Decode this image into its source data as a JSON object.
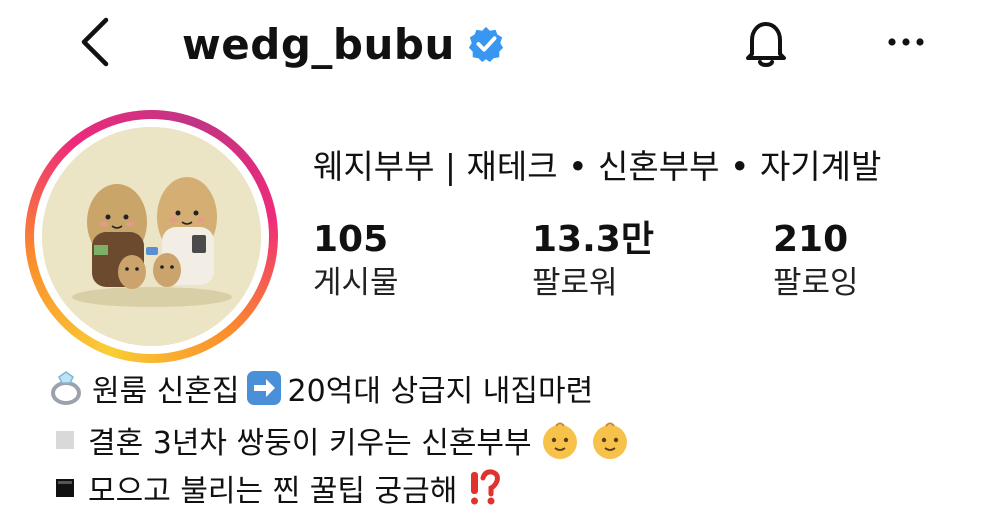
{
  "header": {
    "back_icon": "chevron-left-icon",
    "username": "wedg_bubu",
    "verified_icon": "verified-badge-icon",
    "notification_icon": "bell-icon",
    "more_icon": "more-horizontal-icon"
  },
  "profile": {
    "display_name": "웨지부부 | 재테크 • 신혼부부 • 자기계발",
    "stats": [
      {
        "value": "105",
        "label": "게시물"
      },
      {
        "value": "13.3만",
        "label": "팔로워"
      },
      {
        "value": "210",
        "label": "팔로잉"
      }
    ],
    "avatar_ring_colors": [
      "#f9ce34",
      "#ee2a7b",
      "#c13584"
    ]
  },
  "bio": {
    "line1": {
      "emoji": "ring-icon",
      "text1": "원룸 신혼집",
      "emoji2": "right-arrow-icon",
      "text2": "20억대 상급지 내집마련"
    },
    "line2": {
      "emoji": "white-square-icon",
      "text": "결혼 3년차 쌍둥이 키우는 신혼부부",
      "emoji2": "baby-icon"
    },
    "line3": {
      "emoji": "black-square-icon",
      "text": "모으고 불리는 찐 꿀팁 궁금해",
      "emoji2": "exclamation-question-icon"
    }
  },
  "colors": {
    "verified_blue": "#3897f0",
    "arrow_blue": "#4a90d9"
  }
}
